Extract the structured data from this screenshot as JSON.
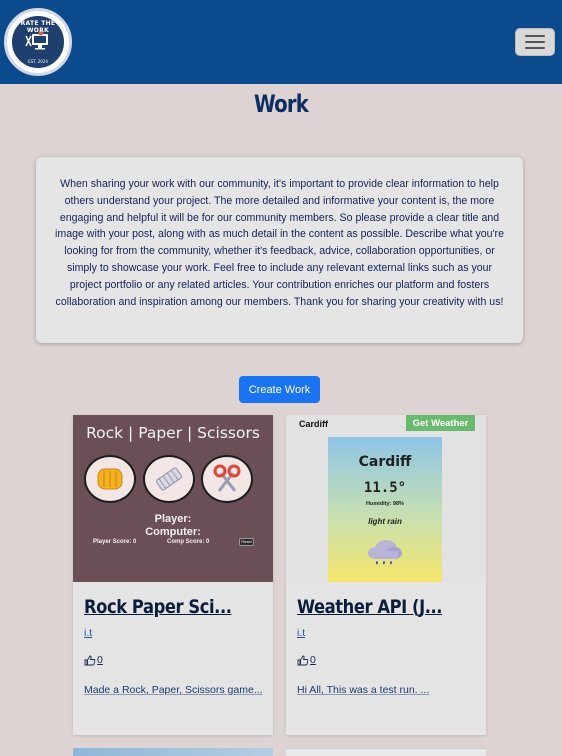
{
  "navbar": {
    "logo_text": "RATE THE WORK",
    "logo_est": "EST. 2024",
    "menu_icon": "hamburger-icon"
  },
  "page": {
    "title": "Work",
    "intro": "When sharing your work with our community, it's important to provide clear information to help others understand your project. The more detailed and informative your content is, the more engaging and helpful it will be for our community members. So please provide a clear title and image with your post, along with as much detail in the content as possible. Describe what you're looking for from the community, whether it's feedback, advice, collaboration opportunities, or simply to showcase your work. Feel free to include any relevant external links such as your project portfolio or any related articles. Your contribution enriches our platform and fosters collaboration and inspiration among our members. Thank you for sharing your creativity with us!",
    "create_button": "Create Work"
  },
  "cards": [
    {
      "title": "Rock Paper Sci...",
      "author": "i.t",
      "likes": "0",
      "like_icon": "thumbs-up-icon",
      "description": "Made a Rock, Paper, Scissors game...",
      "thumbnail": {
        "heading": "Rock | Paper | Scissors",
        "player": "Player:",
        "computer": "Computer:",
        "player_score": "Player Score: 0",
        "comp_score": "Comp Score: 0",
        "reset": "Reset"
      }
    },
    {
      "title": "Weather API (J...",
      "author": "i.t",
      "likes": "0",
      "like_icon": "thumbs-up-icon",
      "description": "Hi All, This was a test run. ...",
      "thumbnail": {
        "city_input": "Cardiff",
        "button": "Get Weather",
        "city": "Cardiff",
        "temp": "11.5°",
        "humidity": "Humidity: 98%",
        "condition": "light rain"
      }
    }
  ],
  "colors": {
    "navbar": "#0b4a8c",
    "background": "#ddd3d3",
    "button": "#1a73f0",
    "weather_button": "#69b96e"
  }
}
